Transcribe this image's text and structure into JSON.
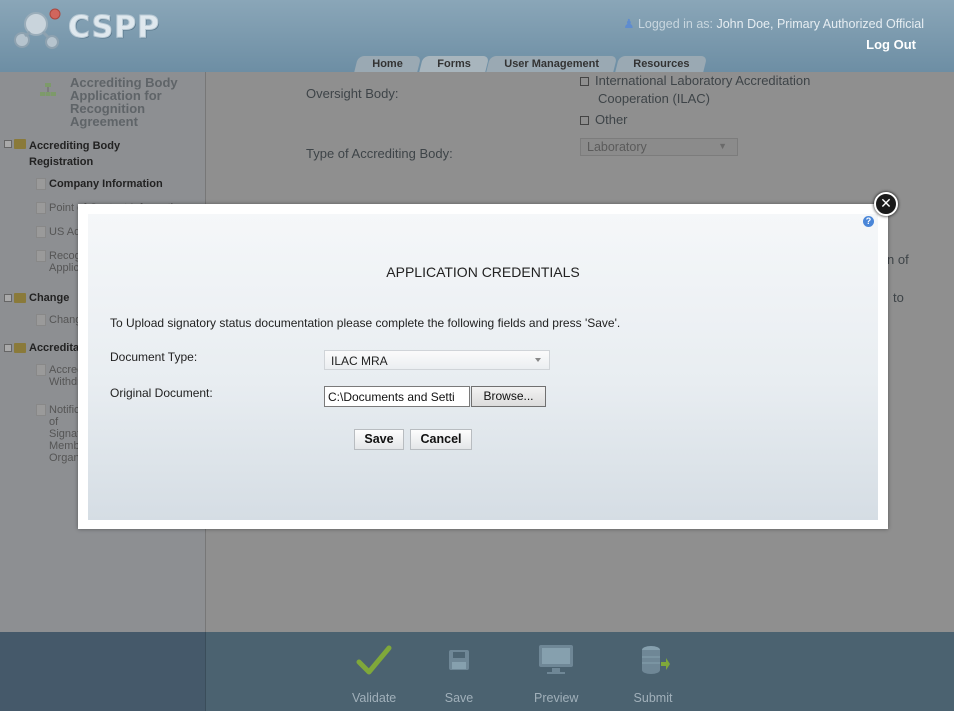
{
  "app": {
    "logo_text": "CSPP",
    "user_line_prefix": "Logged in as:",
    "user_name": "John Doe, Primary Authorized Official",
    "logout_label": "Log Out"
  },
  "tabs": [
    {
      "label": "Home"
    },
    {
      "label": "Forms"
    },
    {
      "label": "User Management"
    },
    {
      "label": "Resources"
    }
  ],
  "sidebar": {
    "title": "Accrediting Body Application for Recognition Agreement",
    "tree": {
      "group1": "Accrediting Body Registration",
      "item_company": "Company Information",
      "item_point": "Point of Contact Information",
      "item_us": "US Address",
      "item_reco": "Recognition Application",
      "group2": "Change",
      "item_change": "Change",
      "group3": "Accreditation",
      "item_accr": "Accreditation Withdrawal",
      "item_notif": "Notification of Signatory Membership Organization"
    }
  },
  "main": {
    "oversight_label": "Oversight Body:",
    "opt_ilac": "International Laboratory Accreditation Cooperation (ILAC)",
    "opt_ilac_line1": "International Laboratory Accreditation",
    "opt_ilac_line2": "Cooperation (ILAC)",
    "opt_other": "Other",
    "type_label": "Type of Accrediting Body:",
    "type_value": "Laboratory",
    "clip_of": "n of",
    "clip_to": "to"
  },
  "modal": {
    "title": "APPLICATION CREDENTIALS",
    "instructions": "To Upload signatory status documentation please complete the following fields and press 'Save'.",
    "doc_type_label": "Document Type:",
    "doc_type_value": "ILAC MRA",
    "orig_doc_label": "Original Document:",
    "orig_doc_value": "C:\\Documents and Setti",
    "browse_label": "Browse...",
    "save_label": "Save",
    "cancel_label": "Cancel",
    "help_glyph": "?",
    "close_glyph": "✕"
  },
  "footer": {
    "validate": "Validate",
    "save": "Save",
    "preview": "Preview",
    "submit": "Submit"
  }
}
